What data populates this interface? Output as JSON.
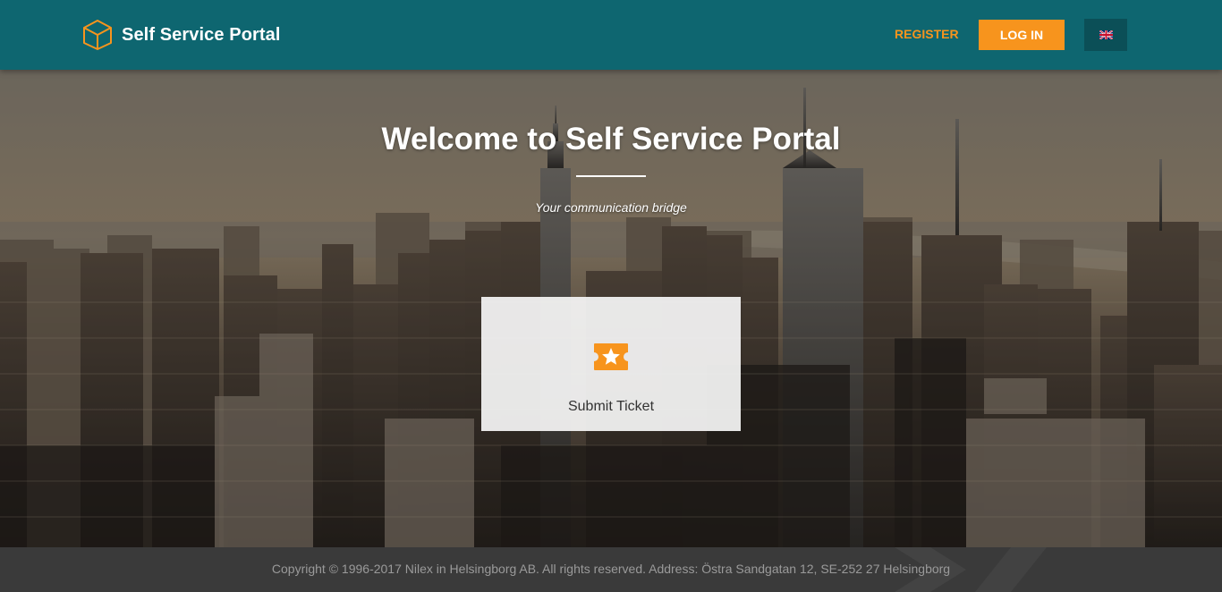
{
  "header": {
    "brand_title": "Self Service Portal",
    "register_label": "REGISTER",
    "login_label": "LOG IN",
    "language_icon": "uk-flag-icon",
    "brand_icon": "cube-icon"
  },
  "hero": {
    "title": "Welcome to Self Service Portal",
    "subtitle": "Your communication bridge",
    "tiles": [
      {
        "label": "Submit Ticket",
        "icon": "ticket-star-icon"
      }
    ]
  },
  "footer": {
    "copyright": "Copyright © 1996-2017 Nilex in Helsingborg AB. All rights reserved. Address: Östra Sandgatan 12, SE-252 27 Helsingborg"
  },
  "colors": {
    "header_bg": "#0e6670",
    "accent": "#f7941d",
    "footer_bg": "#3a3a3a"
  }
}
